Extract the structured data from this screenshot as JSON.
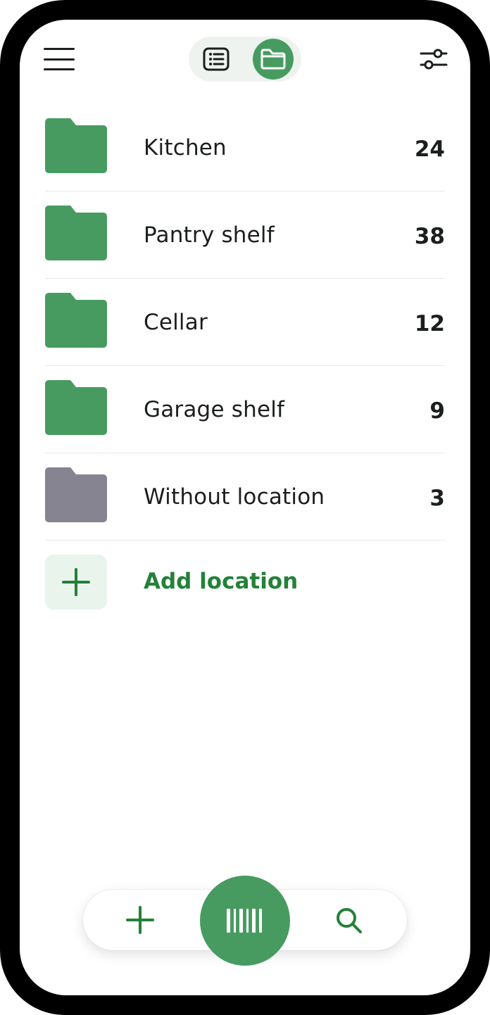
{
  "colors": {
    "accent": "#489b60",
    "accent_text": "#238138",
    "accent_light": "#e9f4ec",
    "folder_muted": "#868490",
    "text": "#1b1f1c",
    "divider": "#e6e8e6"
  },
  "header": {
    "menu_icon": "hamburger-menu-icon",
    "view_toggle": {
      "options": [
        {
          "icon": "list-view-icon",
          "selected": false
        },
        {
          "icon": "folder-view-icon",
          "selected": true
        }
      ]
    },
    "filter_icon": "sliders-filter-icon"
  },
  "locations": [
    {
      "name": "Kitchen",
      "count": "24",
      "folder_color": "#489b60"
    },
    {
      "name": "Pantry shelf",
      "count": "38",
      "folder_color": "#489b60"
    },
    {
      "name": "Cellar",
      "count": "12",
      "folder_color": "#489b60"
    },
    {
      "name": "Garage shelf",
      "count": "9",
      "folder_color": "#489b60"
    },
    {
      "name": "Without location",
      "count": "3",
      "folder_color": "#868490"
    }
  ],
  "add_location": {
    "label": "Add location",
    "icon": "plus-icon"
  },
  "bottom_bar": {
    "add_icon": "plus-icon",
    "scan_icon": "barcode-icon",
    "search_icon": "search-icon"
  }
}
